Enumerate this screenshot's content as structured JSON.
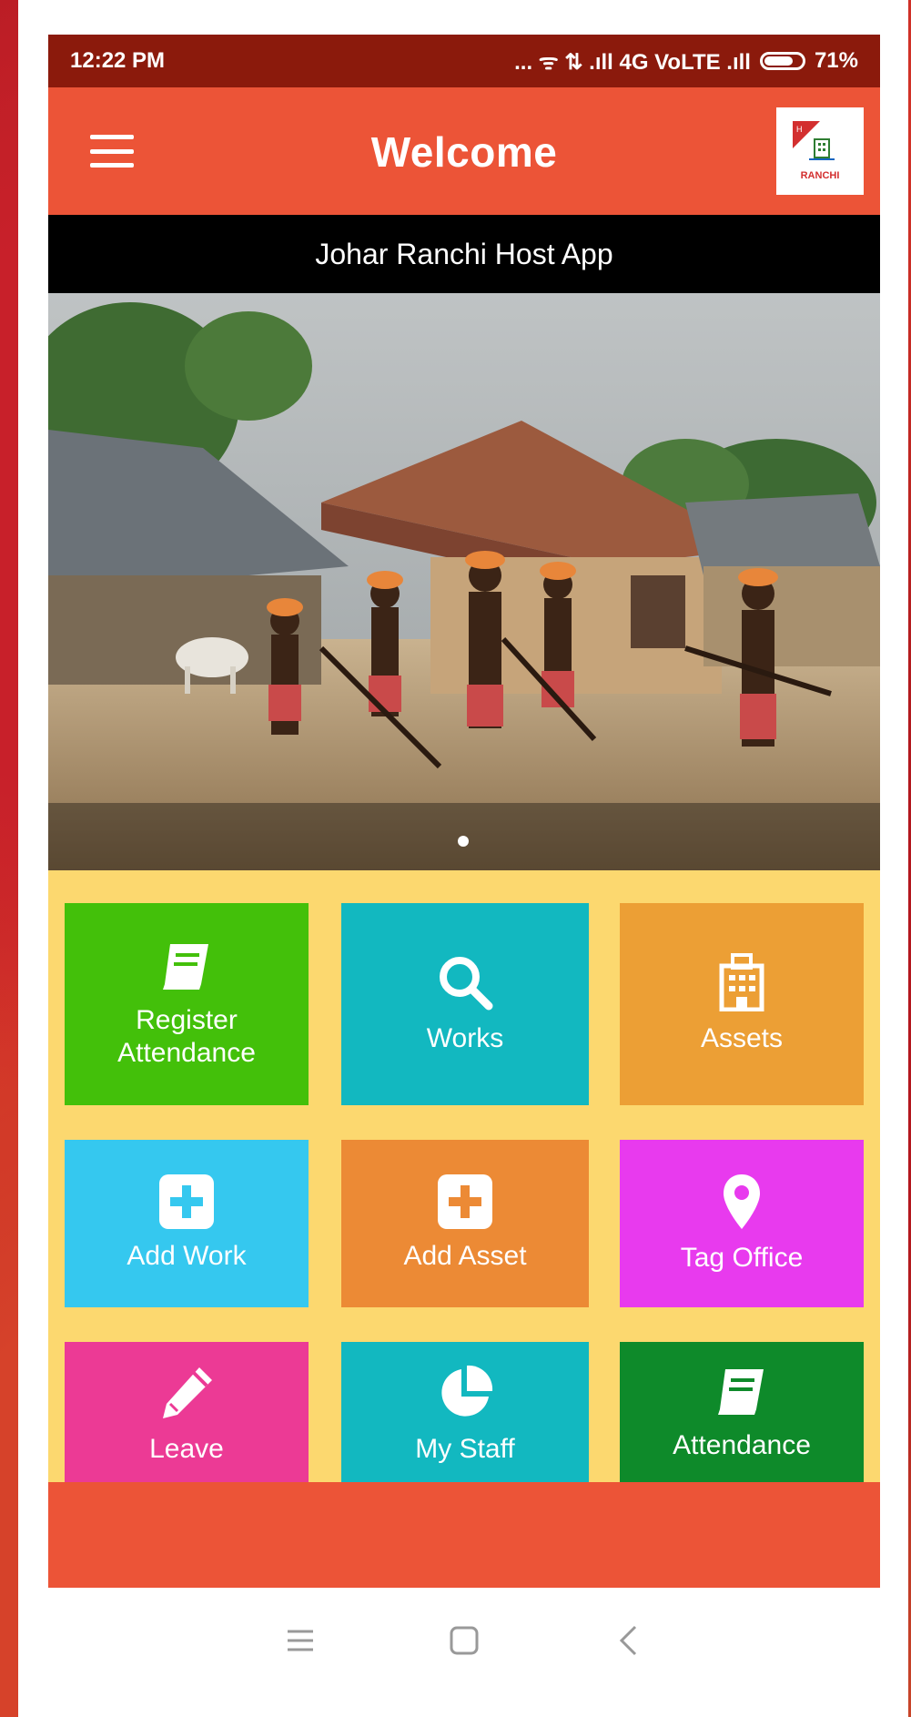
{
  "status_bar": {
    "time": "12:22 PM",
    "network": "... ᯤ ⇅ .ıll 4G VoLTE .ıll",
    "battery_percent": "71%",
    "battery_level": 0.71
  },
  "app_bar": {
    "title": "Welcome",
    "menu_icon": "hamburger-menu-icon",
    "logo_text": "RANCHI"
  },
  "banner": {
    "title": "Johar Ranchi Host App",
    "carousel_index": 1
  },
  "tiles": [
    {
      "label": "Register\nAttendance",
      "icon": "book-icon",
      "color": "#43c00a"
    },
    {
      "label": "Works",
      "icon": "search-icon",
      "color": "#12b8c0"
    },
    {
      "label": "Assets",
      "icon": "building-icon",
      "color": "#ec9f35"
    },
    {
      "label": "Add Work",
      "icon": "plus-square-icon",
      "color": "#35c8ef"
    },
    {
      "label": "Add Asset",
      "icon": "plus-square-icon",
      "color": "#ec8a35"
    },
    {
      "label": "Tag Office",
      "icon": "map-pin-icon",
      "color": "#e83aee"
    },
    {
      "label": "Leave",
      "icon": "pencil-icon",
      "color": "#ec3a95"
    },
    {
      "label": "My Staff",
      "icon": "pie-chart-icon",
      "color": "#12b8c0"
    },
    {
      "label": "Attendance",
      "icon": "book-icon",
      "color": "#0e8a2a"
    }
  ],
  "colors": {
    "primary": "#ec5437",
    "status_bar": "#8b1a0c",
    "tiles_background": "#fcd86f"
  },
  "nav_bar": {
    "recent_icon": "recent-apps-icon",
    "home_icon": "home-icon",
    "back_icon": "back-icon"
  }
}
